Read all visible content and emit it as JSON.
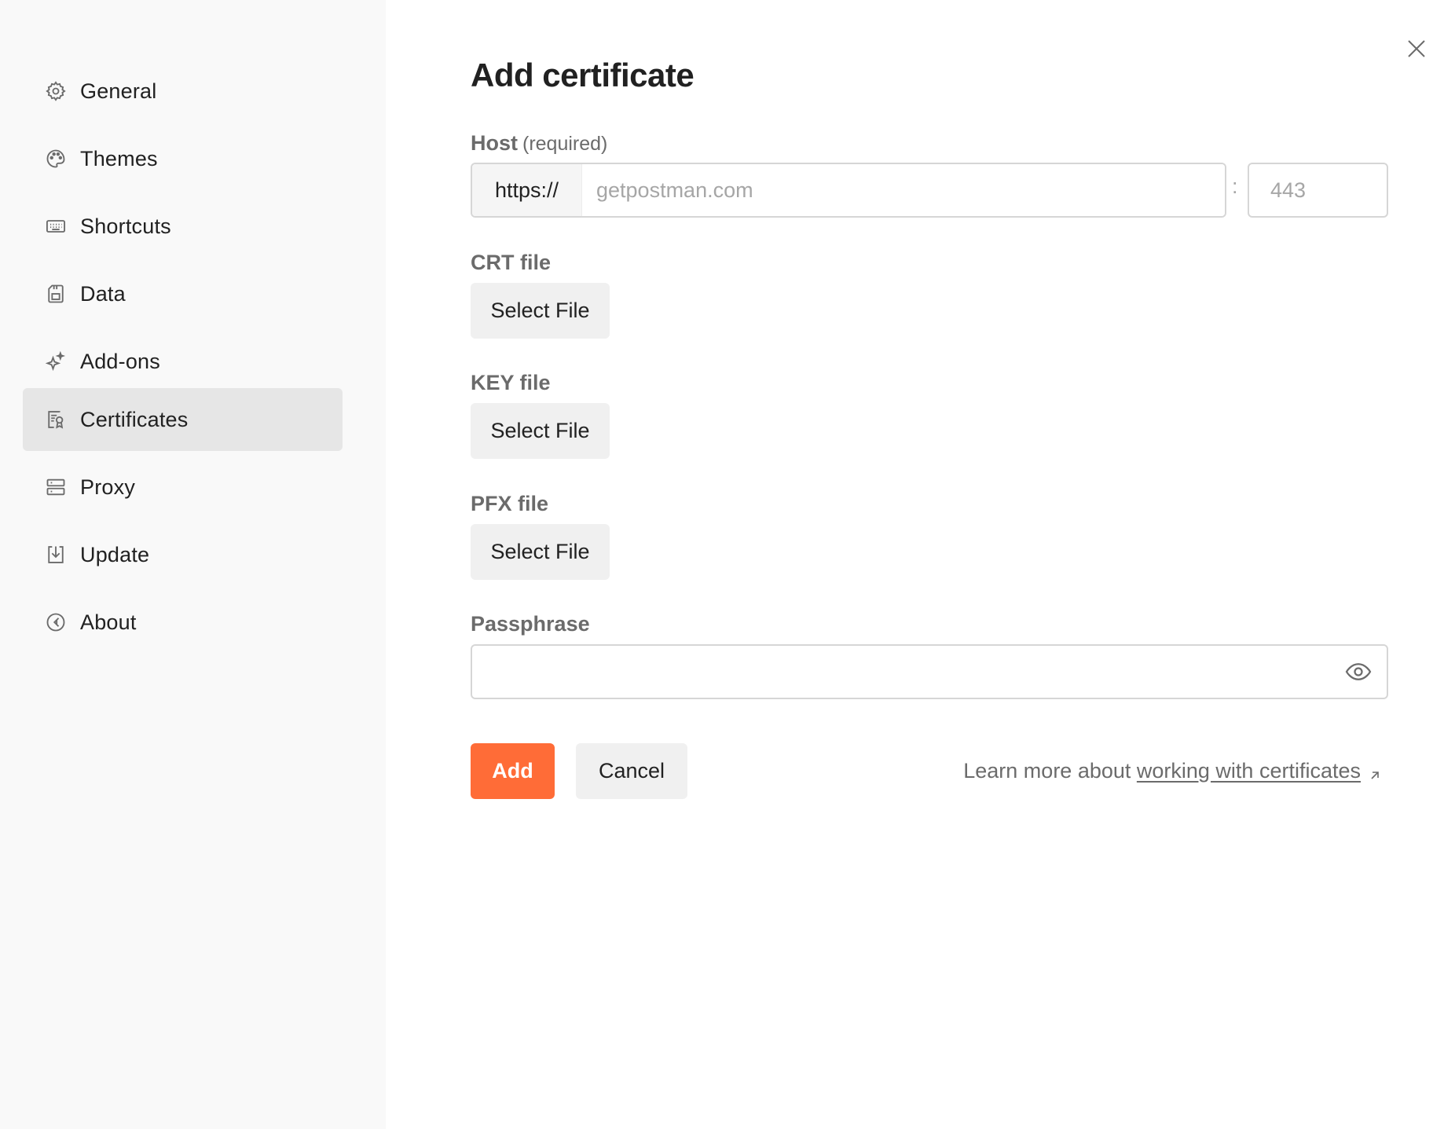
{
  "sidebar": {
    "items": [
      {
        "label": "General",
        "icon": "gear-icon",
        "active": false
      },
      {
        "label": "Themes",
        "icon": "palette-icon",
        "active": false
      },
      {
        "label": "Shortcuts",
        "icon": "keyboard-icon",
        "active": false
      },
      {
        "label": "Data",
        "icon": "data-file-icon",
        "active": false
      },
      {
        "label": "Add-ons",
        "icon": "sparkle-icon",
        "active": false
      },
      {
        "label": "Certificates",
        "icon": "certificate-icon",
        "active": true
      },
      {
        "label": "Proxy",
        "icon": "server-icon",
        "active": false
      },
      {
        "label": "Update",
        "icon": "download-icon",
        "active": false
      },
      {
        "label": "About",
        "icon": "about-icon",
        "active": false
      }
    ]
  },
  "form": {
    "title": "Add certificate",
    "host": {
      "label": "Host",
      "hint": "(required)",
      "prefix": "https://",
      "placeholder": "getpostman.com",
      "value": "",
      "separator": ":",
      "port_placeholder": "443",
      "port_value": ""
    },
    "crt": {
      "label": "CRT file",
      "button": "Select File"
    },
    "key": {
      "label": "KEY file",
      "button": "Select File"
    },
    "pfx": {
      "label": "PFX file",
      "button": "Select File"
    },
    "passphrase": {
      "label": "Passphrase",
      "value": ""
    },
    "actions": {
      "add_label": "Add",
      "cancel_label": "Cancel"
    },
    "learn_more": {
      "prefix": "Learn more about ",
      "link_text": "working with certificates"
    }
  },
  "colors": {
    "accent": "#ff6c37",
    "sidebar_bg": "#f9f9f9",
    "active_item_bg": "#e6e6e6"
  }
}
